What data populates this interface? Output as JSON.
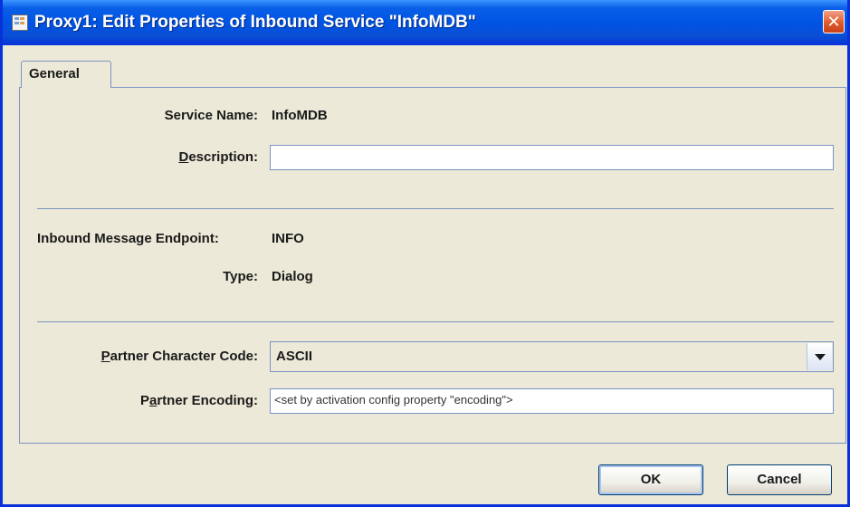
{
  "window": {
    "title": "Proxy1: Edit Properties of Inbound Service \"InfoMDB\"",
    "close_symbol": "✕"
  },
  "tabs": [
    {
      "label": "General",
      "selected": true
    }
  ],
  "form": {
    "service_name": {
      "label": "Service Name:",
      "value": "InfoMDB"
    },
    "description": {
      "label": "Description:",
      "value": ""
    },
    "endpoint": {
      "label": "Inbound Message Endpoint:",
      "value": "INFO"
    },
    "type": {
      "label": "Type:",
      "value": "Dialog"
    },
    "partner_character_code": {
      "label": "Partner Character Code:",
      "value": "ASCII"
    },
    "partner_encoding": {
      "label": "Partner Encoding:",
      "value": "<set by activation config property \"encoding\">"
    }
  },
  "buttons": {
    "ok": "OK",
    "cancel": "Cancel"
  },
  "colors": {
    "title_bar": "#0054e3",
    "dialog_bg": "#ece9d8",
    "border_accent": "#7a93c2",
    "close_button": "#e05a2a"
  },
  "icons": [
    "app-window-icon",
    "close-icon",
    "dropdown-arrow-icon"
  ]
}
